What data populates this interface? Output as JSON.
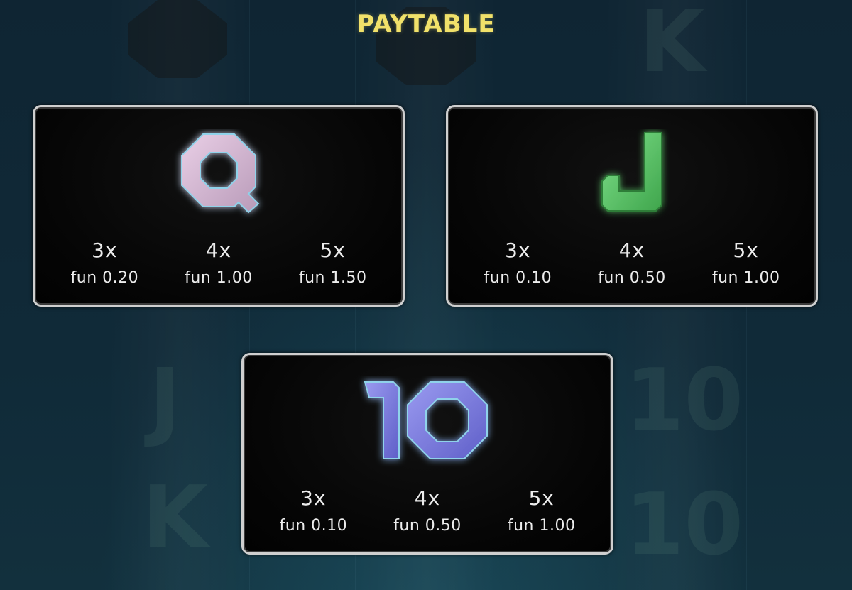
{
  "title": "PAYTABLE",
  "colors": {
    "title": "#f1e16a",
    "card_border": "#cfcfcf",
    "text": "#ececec",
    "q_symbol": "#d9b8d6",
    "j_symbol": "#5ec96a",
    "ten_symbol": "#7f7fe0"
  },
  "cards": [
    {
      "symbol": "Q",
      "icon": "q-symbol-icon",
      "pays": [
        {
          "count": "3x",
          "amount": "fun 0.20"
        },
        {
          "count": "4x",
          "amount": "fun 1.00"
        },
        {
          "count": "5x",
          "amount": "fun 1.50"
        }
      ]
    },
    {
      "symbol": "J",
      "icon": "j-symbol-icon",
      "pays": [
        {
          "count": "3x",
          "amount": "fun 0.10"
        },
        {
          "count": "4x",
          "amount": "fun 0.50"
        },
        {
          "count": "5x",
          "amount": "fun 1.00"
        }
      ]
    },
    {
      "symbol": "10",
      "icon": "ten-symbol-icon",
      "pays": [
        {
          "count": "3x",
          "amount": "fun 0.10"
        },
        {
          "count": "4x",
          "amount": "fun 0.50"
        },
        {
          "count": "5x",
          "amount": "fun 1.00"
        }
      ]
    }
  ]
}
